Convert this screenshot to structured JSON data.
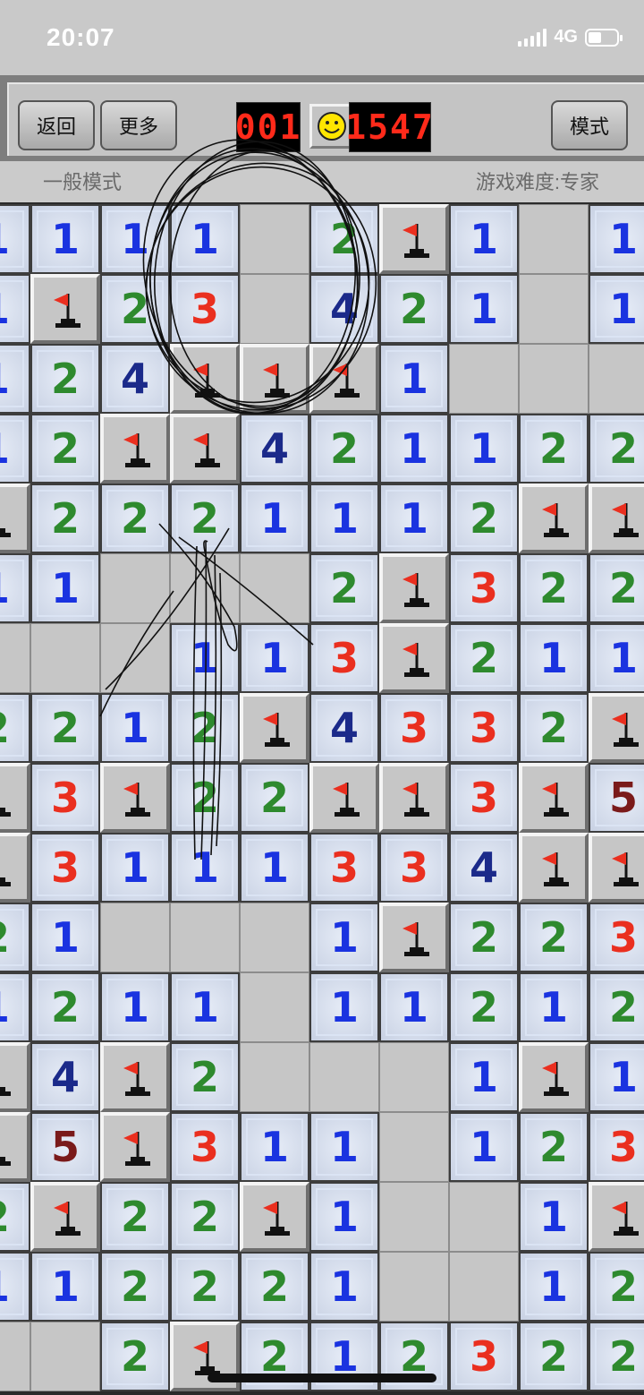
{
  "status_bar": {
    "time": "20:07",
    "network": "4G"
  },
  "toolbar": {
    "back_label": "返回",
    "more_label": "更多",
    "mine_counter": "001",
    "timer": "1547",
    "mode_label": "模式"
  },
  "info": {
    "mode_text": "一般模式",
    "difficulty_text": "游戏难度:专家"
  },
  "colors": {
    "1": "#1a33e0",
    "2": "#2e8a2e",
    "3": "#ea2f1f",
    "4": "#1b2a8a",
    "5": "#7a1a1a",
    "led": "#ff2a1a"
  },
  "grid": [
    "1111_2F1_1",
    "1F23_4211_1",
    "124FFF1___",
    "12FF4211222",
    "F222111FF",
    "11__2F322",
    "__1113F211",
    "2212F43322",
    "F3F22FF3F5",
    "F31113341FF",
    "21___1F223",
    "1211_11212",
    "F4F2___1F1",
    "F5F311_123",
    "2F22F1__1F",
    "1122221__12",
    "__2F21232 2"
  ],
  "board_rows": [
    [
      "1",
      "1",
      "1",
      "1",
      "_",
      "2",
      "F",
      "1",
      "_",
      "1"
    ],
    [
      "1",
      "F",
      "2",
      "3",
      "_",
      "4",
      "2",
      "1",
      "_",
      "1"
    ],
    [
      "1",
      "2",
      "4",
      "F",
      "F",
      "F",
      "1",
      "_",
      "_",
      "_"
    ],
    [
      "1",
      "2",
      "F",
      "F",
      "4",
      "2",
      "1",
      "1",
      "2",
      "2"
    ],
    [
      "F",
      "2",
      "2",
      "2",
      "1",
      "1",
      "1",
      "2",
      "F",
      "F"
    ],
    [
      "1",
      "1",
      "_",
      "_",
      "_",
      "2",
      "F",
      "3",
      "2",
      "2"
    ],
    [
      "_",
      "_",
      "_",
      "1",
      "1",
      "3",
      "F",
      "2",
      "1",
      "1"
    ],
    [
      "2",
      "2",
      "1",
      "2",
      "F",
      "4",
      "3",
      "3",
      "2",
      "F"
    ],
    [
      "F",
      "3",
      "F",
      "2",
      "2",
      "F",
      "F",
      "3",
      "F",
      "5"
    ],
    [
      "F",
      "3",
      "1",
      "1",
      "1",
      "3",
      "3",
      "4",
      "F",
      "F"
    ],
    [
      "2",
      "1",
      "_",
      "_",
      "_",
      "1",
      "F",
      "2",
      "2",
      "3"
    ],
    [
      "1",
      "2",
      "1",
      "1",
      "_",
      "1",
      "1",
      "2",
      "1",
      "2"
    ],
    [
      "F",
      "4",
      "F",
      "2",
      "_",
      "_",
      "_",
      "1",
      "F",
      "1"
    ],
    [
      "F",
      "5",
      "F",
      "3",
      "1",
      "1",
      "_",
      "1",
      "2",
      "3"
    ],
    [
      "2",
      "F",
      "2",
      "2",
      "F",
      "1",
      "_",
      "_",
      "1",
      "F"
    ],
    [
      "1",
      "1",
      "2",
      "2",
      "2",
      "1",
      "_",
      "_",
      "1",
      "2"
    ],
    [
      "_",
      "_",
      "2",
      "F",
      "2",
      "1",
      "2",
      "3",
      "2",
      "2"
    ]
  ]
}
